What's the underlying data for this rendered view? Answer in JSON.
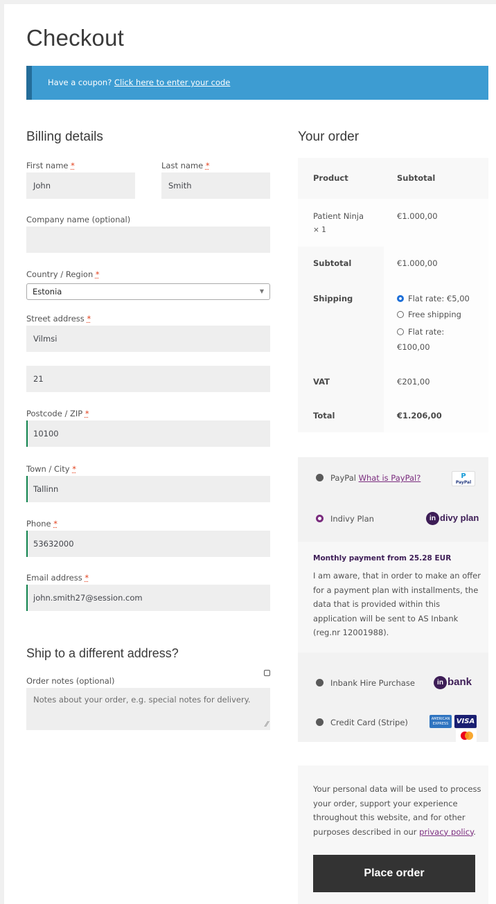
{
  "page": {
    "title": "Checkout"
  },
  "coupon": {
    "prefix": "Have a coupon?",
    "link": "Click here to enter your code"
  },
  "billing": {
    "heading": "Billing details",
    "first_name": {
      "label": "First name",
      "value": "John"
    },
    "last_name": {
      "label": "Last name",
      "value": "Smith"
    },
    "company": {
      "label": "Company name (optional)",
      "value": ""
    },
    "country": {
      "label": "Country / Region",
      "value": "Estonia"
    },
    "street": {
      "label": "Street address",
      "value": "Vilmsi",
      "value2": "21"
    },
    "postcode": {
      "label": "Postcode / ZIP",
      "value": "10100"
    },
    "city": {
      "label": "Town / City",
      "value": "Tallinn"
    },
    "phone": {
      "label": "Phone",
      "value": "53632000"
    },
    "email": {
      "label": "Email address",
      "value": "john.smith27@session.com"
    },
    "required_mark": "*"
  },
  "shipping": {
    "heading": "Ship to a different address?"
  },
  "notes": {
    "label": "Order notes (optional)",
    "placeholder": "Notes about your order, e.g. special notes for delivery."
  },
  "order": {
    "heading": "Your order",
    "col_product": "Product",
    "col_subtotal": "Subtotal",
    "item_name": "Patient Ninja",
    "item_qty": "× 1",
    "item_price": "€1.000,00",
    "subtotal_label": "Subtotal",
    "subtotal_value": "€1.000,00",
    "shipping_label": "Shipping",
    "shipping_options": [
      "Flat rate: €5,00",
      "Free shipping",
      "Flat rate:",
      "€100,00"
    ],
    "vat_label": "VAT",
    "vat_value": "€201,00",
    "total_label": "Total",
    "total_value": "€1.206,00"
  },
  "payment": {
    "paypal": "PayPal",
    "paypal_link": "What is PayPal?",
    "indivy": "Indivy Plan",
    "indivy_logo": "divy plan",
    "indivy_logo_mark": "in",
    "desc_title": "Monthly payment from 25.28 EUR",
    "desc_text": "I am aware, that in order to make an offer for a payment plan with installments, the data that is provided within this application will be sent to AS Inbank (reg.nr 12001988).",
    "inbank": "Inbank Hire Purchase",
    "inbank_logo": "bank",
    "inbank_logo_mark": "in",
    "card": "Credit Card (Stripe)",
    "visa": "VISA"
  },
  "privacy": {
    "text": "Your personal data will be used to process your order, support your experience throughout this website, and for other purposes described in our",
    "link": "privacy policy",
    "end": "."
  },
  "place_order": "Place order"
}
